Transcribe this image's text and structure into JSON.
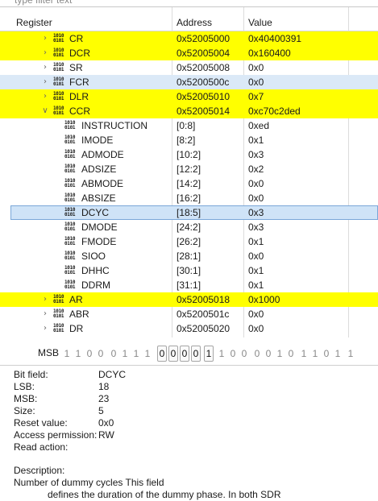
{
  "filter": {
    "placeholder": "type filter text"
  },
  "columns": {
    "register": "Register",
    "address": "Address",
    "value": "Value"
  },
  "rows": [
    {
      "name": "CR",
      "address": "0x52005000",
      "value": "0x40400391",
      "level": 0,
      "expanded": false,
      "style": "highlight"
    },
    {
      "name": "DCR",
      "address": "0x52005004",
      "value": "0x160400",
      "level": 0,
      "expanded": false,
      "style": "highlight"
    },
    {
      "name": "SR",
      "address": "0x52005008",
      "value": "0x0",
      "level": 0,
      "expanded": false,
      "style": "normal"
    },
    {
      "name": "FCR",
      "address": "0x5200500c",
      "value": "0x0",
      "level": 0,
      "expanded": false,
      "style": "hover"
    },
    {
      "name": "DLR",
      "address": "0x52005010",
      "value": "0x7",
      "level": 0,
      "expanded": false,
      "style": "highlight"
    },
    {
      "name": "CCR",
      "address": "0x52005014",
      "value": "0xc70c2ded",
      "level": 0,
      "expanded": true,
      "style": "highlight"
    },
    {
      "name": "INSTRUCTION",
      "address": "[0:8]",
      "value": "0xed",
      "level": 1,
      "style": "normal"
    },
    {
      "name": "IMODE",
      "address": "[8:2]",
      "value": "0x1",
      "level": 1,
      "style": "normal"
    },
    {
      "name": "ADMODE",
      "address": "[10:2]",
      "value": "0x3",
      "level": 1,
      "style": "normal"
    },
    {
      "name": "ADSIZE",
      "address": "[12:2]",
      "value": "0x2",
      "level": 1,
      "style": "normal"
    },
    {
      "name": "ABMODE",
      "address": "[14:2]",
      "value": "0x0",
      "level": 1,
      "style": "normal"
    },
    {
      "name": "ABSIZE",
      "address": "[16:2]",
      "value": "0x0",
      "level": 1,
      "style": "normal"
    },
    {
      "name": "DCYC",
      "address": "[18:5]",
      "value": "0x3",
      "level": 1,
      "style": "selected"
    },
    {
      "name": "DMODE",
      "address": "[24:2]",
      "value": "0x3",
      "level": 1,
      "style": "normal"
    },
    {
      "name": "FMODE",
      "address": "[26:2]",
      "value": "0x1",
      "level": 1,
      "style": "normal"
    },
    {
      "name": "SIOO",
      "address": "[28:1]",
      "value": "0x0",
      "level": 1,
      "style": "normal"
    },
    {
      "name": "DHHC",
      "address": "[30:1]",
      "value": "0x1",
      "level": 1,
      "style": "normal"
    },
    {
      "name": "DDRM",
      "address": "[31:1]",
      "value": "0x1",
      "level": 1,
      "style": "normal"
    },
    {
      "name": "AR",
      "address": "0x52005018",
      "value": "0x1000",
      "level": 0,
      "expanded": false,
      "style": "highlight"
    },
    {
      "name": "ABR",
      "address": "0x5200501c",
      "value": "0x0",
      "level": 0,
      "expanded": false,
      "style": "normal"
    },
    {
      "name": "DR",
      "address": "0x52005020",
      "value": "0x0",
      "level": 0,
      "expanded": false,
      "style": "normal"
    }
  ],
  "icons": {
    "register": "binary-register-icon",
    "expand": "chevron-right-icon",
    "collapse": "chevron-down-icon"
  },
  "colors": {
    "highlight": "#ffff00",
    "selected": "#d6d6d6",
    "hover": "#dbe9f7"
  },
  "bits": {
    "label": "MSB",
    "digits": [
      "1",
      "1",
      "0",
      "0",
      "0",
      "1",
      "1",
      "1",
      "0",
      "0",
      "0",
      "0",
      "1",
      "1",
      "0",
      "0",
      "0",
      "0",
      "1",
      "0",
      "1",
      "1",
      "0",
      "1",
      "1"
    ],
    "field_start": 8,
    "field_end": 12
  },
  "details": [
    {
      "key": "Bit field:",
      "value": "DCYC"
    },
    {
      "key": "LSB:",
      "value": "18"
    },
    {
      "key": "MSB:",
      "value": "23"
    },
    {
      "key": "Size:",
      "value": "5"
    },
    {
      "key": "Reset value:",
      "value": "0x0"
    },
    {
      "key": "Access permission:",
      "value": "RW"
    },
    {
      "key": "Read action:",
      "value": ""
    }
  ],
  "description": {
    "title": "Description:",
    "line1": "Number of dummy cycles This field",
    "line2": "defines the duration of the dummy phase. In both SDR"
  }
}
